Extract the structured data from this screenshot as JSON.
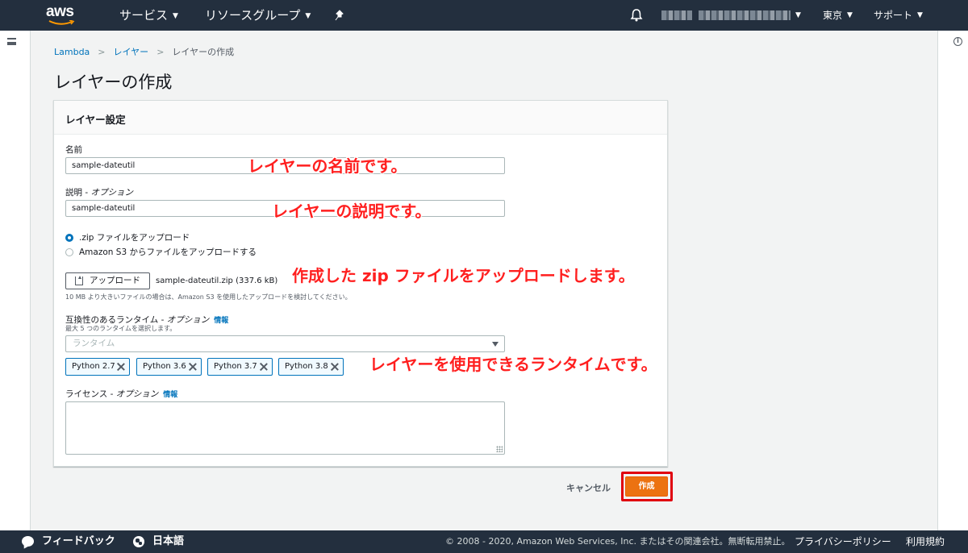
{
  "header": {
    "logo": "aws",
    "services": "サービス",
    "resource_groups": "リソースグループ",
    "region": "東京",
    "support": "サポート"
  },
  "breadcrumb": {
    "root": "Lambda",
    "parent": "レイヤー",
    "current": "レイヤーの作成"
  },
  "page": {
    "title": "レイヤーの作成"
  },
  "panel": {
    "title": "レイヤー設定",
    "name_label": "名前",
    "name_value": "sample-dateutil",
    "description_label": "説明",
    "description_optional": "オプション",
    "description_value": "sample-dateutil",
    "upload_options": [
      {
        "label": ".zip ファイルをアップロード",
        "checked": true
      },
      {
        "label": "Amazon S3 からファイルをアップロードする",
        "checked": false
      }
    ],
    "upload_button": "アップロード",
    "uploaded_file": "sample-dateutil.zip (337.6 kB)",
    "upload_hint": "10 MB より大きいファイルの場合は、Amazon S3 を使用したアップロードを検討してください。",
    "runtime_label": "互換性のあるランタイム",
    "runtime_optional": "オプション",
    "runtime_info": "情報",
    "runtime_sublabel": "最大 5 つのランタイムを選択します。",
    "runtime_placeholder": "ランタイム",
    "runtimes_selected": [
      "Python 2.7",
      "Python 3.6",
      "Python 3.7",
      "Python 3.8"
    ],
    "license_label": "ライセンス",
    "license_optional": "オプション",
    "license_info": "情報"
  },
  "actions": {
    "cancel": "キャンセル",
    "create": "作成"
  },
  "annotations": {
    "name": "レイヤーの名前です。",
    "description": "レイヤーの説明です。",
    "upload": "作成した zip ファイルをアップロードします。",
    "runtime": "レイヤーを使用できるランタイムです。"
  },
  "footer": {
    "feedback": "フィードバック",
    "language": "日本語",
    "copyright": "© 2008 - 2020, Amazon Web Services, Inc. またはその関連会社。無断転用禁止。",
    "privacy": "プライバシーポリシー",
    "terms": "利用規約"
  },
  "colors": {
    "nav_bg": "#232f3e",
    "link": "#0073bb",
    "primary_button": "#ec7211",
    "annotation": "#ff1f1f",
    "highlight_border": "#e0000f"
  },
  "icons": [
    "hamburger-icon",
    "info-icon",
    "pin-icon",
    "bell-icon",
    "upload-icon",
    "close-icon",
    "caret-down-icon",
    "feedback-icon",
    "globe-icon"
  ]
}
